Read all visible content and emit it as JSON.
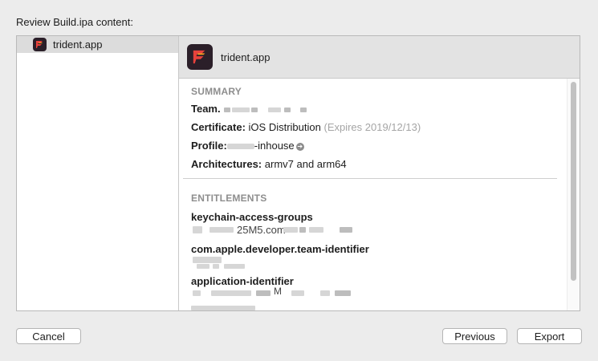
{
  "header": {
    "label": "Review Build.ipa content:"
  },
  "sidebar": {
    "items": [
      {
        "label": "trident.app",
        "icon": "app-icon"
      }
    ]
  },
  "detail": {
    "title": "trident.app",
    "summary": {
      "heading": "SUMMARY",
      "team_label": "Team.",
      "certificate_label": "Certificate:",
      "certificate_value": "iOS Distribution",
      "certificate_expiry": "(Expires 2019/12/13)",
      "profile_label": "Profile:",
      "profile_value": "-inhouse",
      "architectures_label": "Architectures:",
      "architectures_value": "armv7 and arm64"
    },
    "entitlements": {
      "heading": "ENTITLEMENTS",
      "keys": [
        "keychain-access-groups",
        "com.apple.developer.team-identifier",
        "application-identifier"
      ],
      "partial_texts": [
        "25M5.com",
        "M"
      ]
    }
  },
  "footer": {
    "cancel": "Cancel",
    "previous": "Previous",
    "export": "Export"
  },
  "colors": {
    "app_icon_bg": "#2b1f29",
    "app_icon_red": "#e8423c",
    "app_icon_orange": "#f5a623",
    "selection": "#dcdcdc"
  }
}
